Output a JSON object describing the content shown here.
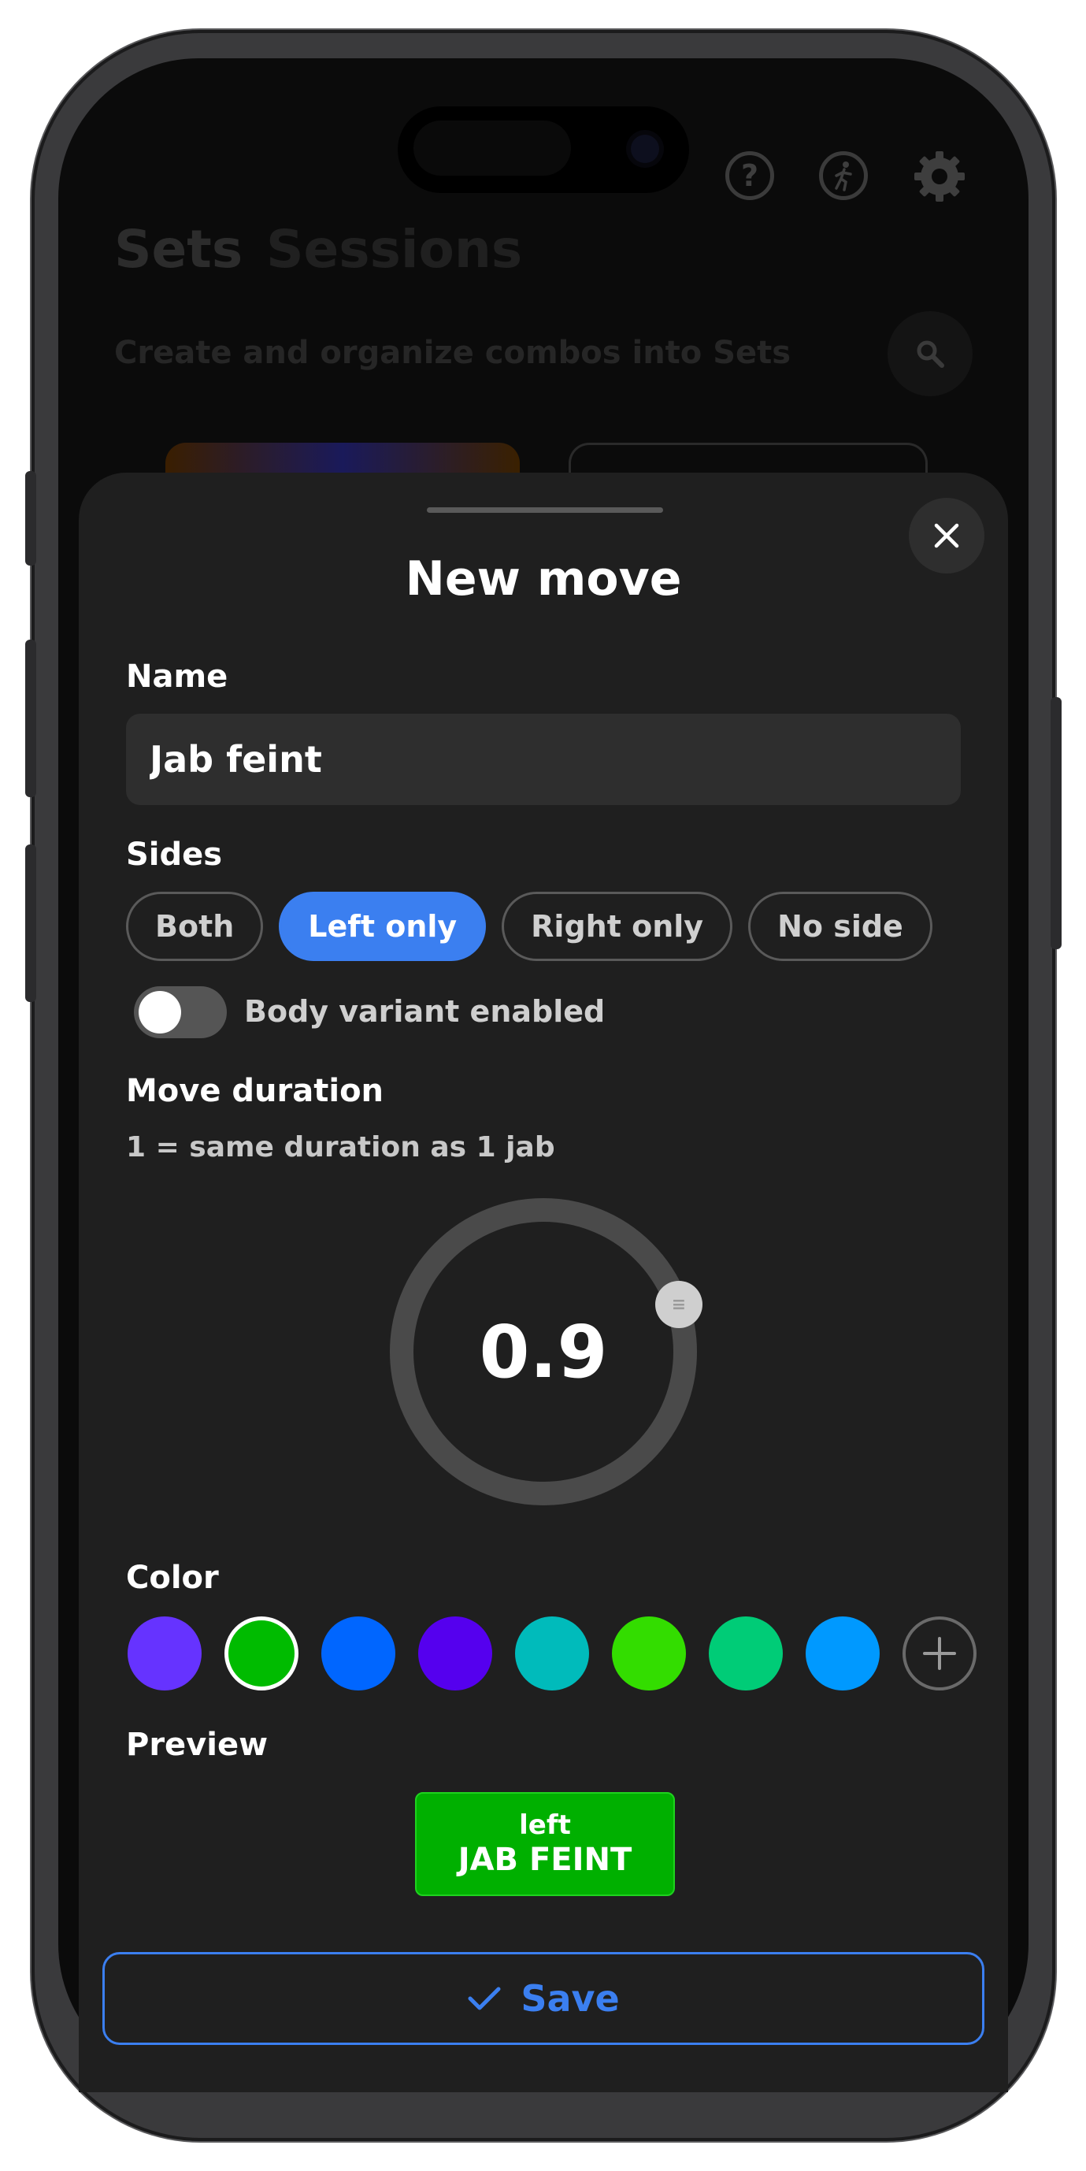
{
  "background": {
    "tabs": [
      "Sets",
      "Sessions"
    ],
    "subtitle": "Create and organize combos into Sets",
    "top_icons": [
      "help-icon",
      "figure-icon",
      "gear-icon"
    ]
  },
  "sheet": {
    "title": "New move",
    "name_label": "Name",
    "name_value": "Jab feint",
    "sides_label": "Sides",
    "sides": [
      "Both",
      "Left only",
      "Right only",
      "No side"
    ],
    "sides_selected": "Left only",
    "body_variant_label": "Body variant enabled",
    "body_variant_enabled": false,
    "duration_label": "Move duration",
    "duration_hint": "1 = same duration as 1 jab",
    "duration_value": "0.9",
    "duration_level": 0.9,
    "color_label": "Color",
    "colors": [
      "#6633ff",
      "#00bb00",
      "#0066ff",
      "#5500ee",
      "#00bbbb",
      "#33dd00",
      "#00cc77",
      "#0099ff"
    ],
    "color_selected": "#00bb00",
    "preview_label": "Preview",
    "preview_side": "left",
    "preview_name": "JAB FEINT",
    "save_label": "Save"
  },
  "accent_color": "#3b7ff0"
}
